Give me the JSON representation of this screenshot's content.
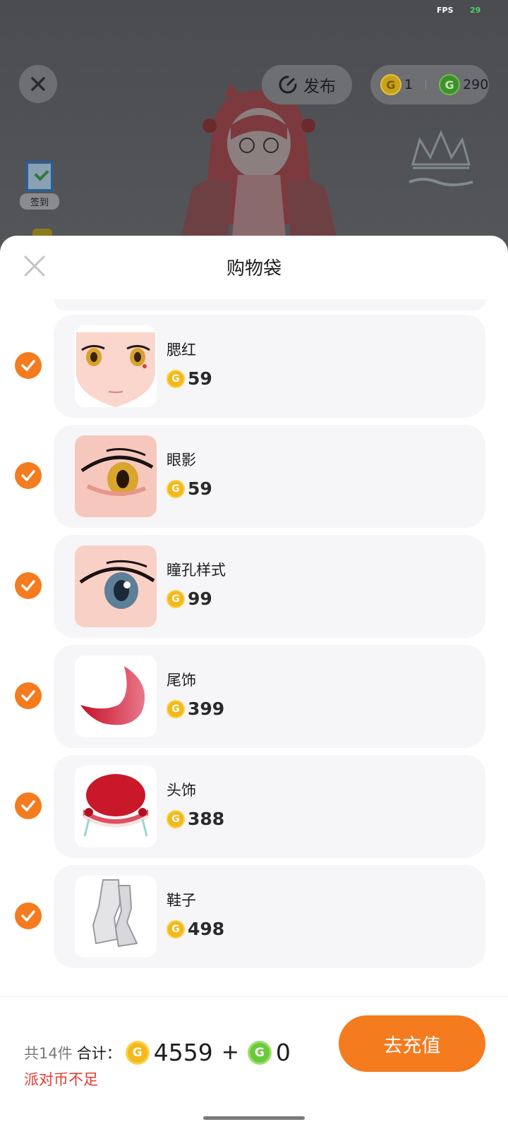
{
  "status": {
    "fps_label": "FPS",
    "fps_value": "29"
  },
  "scene": {
    "publish_label": "发布",
    "gold_coin_count": "1",
    "green_coin_count": "290",
    "checkin_label": "签到",
    "coin_glyph": "G"
  },
  "sheet": {
    "title": "购物袋",
    "items": [
      {
        "name": "腮红",
        "price": "59",
        "checked": true,
        "thumb_icon": "blush-face-thumb"
      },
      {
        "name": "眼影",
        "price": "59",
        "checked": true,
        "thumb_icon": "eyeshadow-eye-thumb"
      },
      {
        "name": "瞳孔样式",
        "price": "99",
        "checked": true,
        "thumb_icon": "pupil-eye-thumb"
      },
      {
        "name": "尾饰",
        "price": "399",
        "checked": true,
        "thumb_icon": "red-tail-thumb"
      },
      {
        "name": "头饰",
        "price": "388",
        "checked": true,
        "thumb_icon": "red-headdress-thumb"
      },
      {
        "name": "鞋子",
        "price": "498",
        "checked": true,
        "thumb_icon": "white-boots-thumb"
      }
    ]
  },
  "footer": {
    "count_text": "共14件",
    "total_label": "合计：",
    "gold_total": "4559",
    "plus": "+",
    "green_total": "0",
    "warning": "派对币不足",
    "recharge_label": "去充值"
  },
  "colors": {
    "accent": "#f47b1e",
    "warning": "#e53a2f",
    "gold_coin": "#f3b81a",
    "green_coin": "#6bc93d"
  }
}
